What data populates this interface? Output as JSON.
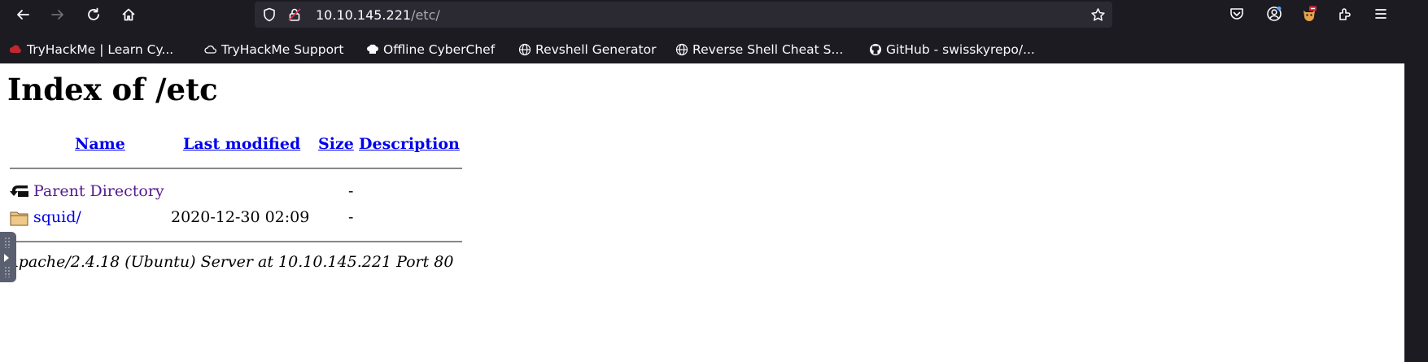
{
  "browser": {
    "url_host": "10.10.145.221",
    "url_path": "/etc/",
    "icons": [
      "back-arrow-icon",
      "forward-arrow-icon",
      "reload-icon",
      "home-icon",
      "shield-icon",
      "insecure-lock-icon",
      "bookmark-star-icon",
      "pocket-icon",
      "account-icon",
      "extension-fox-icon",
      "extensions-icon",
      "menu-icon"
    ]
  },
  "bookmarks": [
    {
      "label": "TryHackMe | Learn Cy...",
      "icon": "tryhackme-icon"
    },
    {
      "label": "TryHackMe Support",
      "icon": "cloud-icon"
    },
    {
      "label": "Offline CyberChef",
      "icon": "chef-hat-icon"
    },
    {
      "label": "Revshell Generator",
      "icon": "globe-icon"
    },
    {
      "label": "Reverse Shell Cheat S...",
      "icon": "globe-icon"
    },
    {
      "label": "GitHub - swisskyrepo/...",
      "icon": "github-icon"
    }
  ],
  "page": {
    "title": "Index of /etc",
    "columns": [
      "Name",
      "Last modified",
      "Size",
      "Description"
    ],
    "rows": [
      {
        "name": "Parent Directory",
        "modified": "",
        "size": "-",
        "description": "",
        "icon": "back-folder-icon"
      },
      {
        "name": "squid/",
        "modified": "2020-12-30 02:09",
        "size": "-",
        "description": "",
        "icon": "folder-icon"
      }
    ],
    "address": "Apache/2.4.18 (Ubuntu) Server at 10.10.145.221 Port 80"
  }
}
